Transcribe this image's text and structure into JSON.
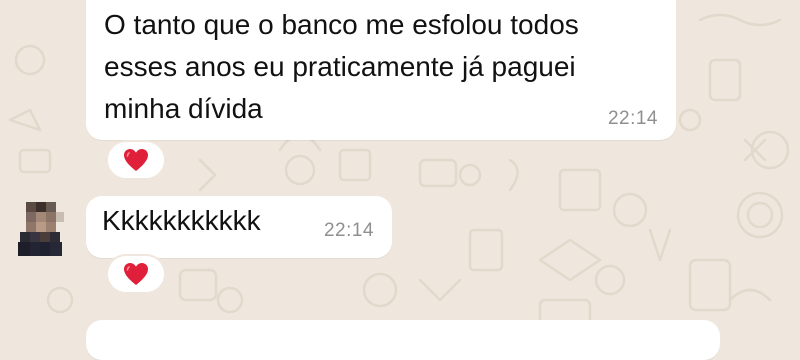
{
  "chat": {
    "messages": [
      {
        "text": "O tanto que o banco me esfolou todos\nesses anos eu praticamente já paguei\nminha dívida",
        "time": "22:14",
        "reaction": "heart"
      },
      {
        "text": "Kkkkkkkkkkk",
        "time": "22:14",
        "reaction": "heart"
      }
    ]
  },
  "colors": {
    "background": "#efe7dd",
    "bubble": "#ffffff",
    "text": "#111111",
    "timestamp": "#8f8f8f",
    "heart": "#e0203a"
  }
}
